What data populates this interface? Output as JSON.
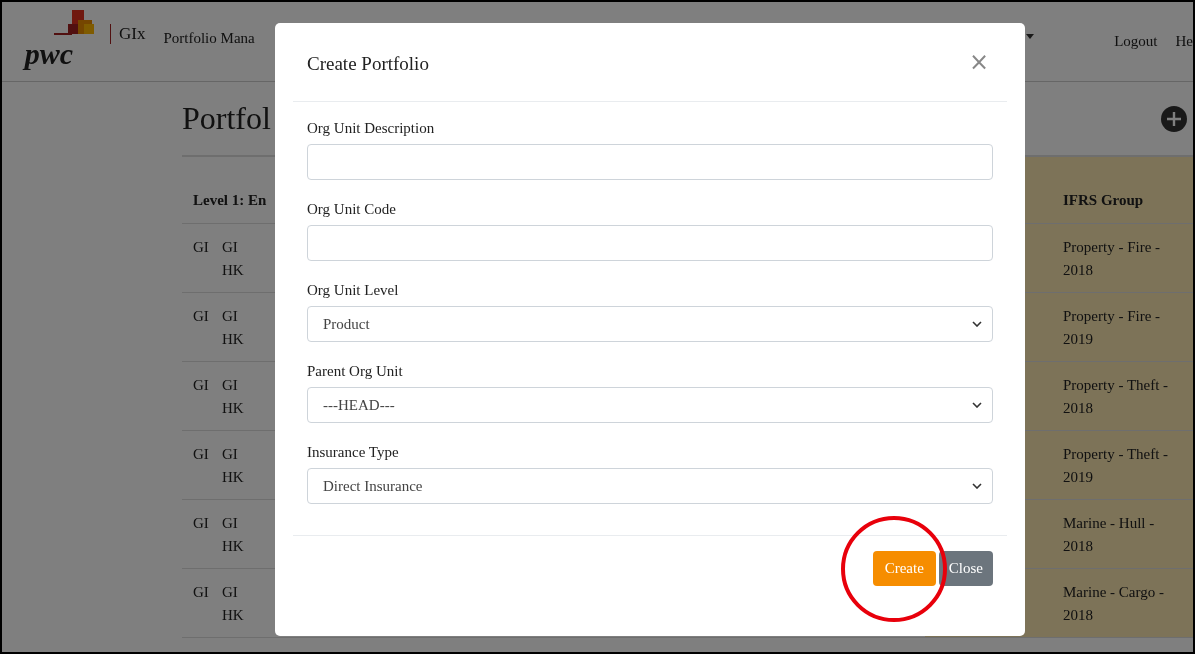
{
  "header": {
    "logo": "pwc",
    "product": "GIx",
    "nav": [
      "Portfolio Mana"
    ],
    "links": [
      "Logout",
      "He"
    ]
  },
  "page": {
    "title": "Portfol",
    "table": {
      "columns": [
        {
          "label": "Level 1: En",
          "highlighted": false
        },
        {
          "label": "IFRS Group",
          "highlighted": true
        }
      ],
      "rows": [
        {
          "level_1": "GI",
          "column_2": "GI HK",
          "ifrs_group": "Property - Fire - 2018"
        },
        {
          "level_1": "GI",
          "column_2": "GI HK",
          "ifrs_group": "Property - Fire - 2019"
        },
        {
          "level_1": "GI",
          "column_2": "GI HK",
          "ifrs_group": "Property - Theft - 2018"
        },
        {
          "level_1": "GI",
          "column_2": "GI HK",
          "ifrs_group": "Property - Theft - 2019"
        },
        {
          "level_1": "GI",
          "column_2": "GI HK",
          "ifrs_group": "Marine - Hull - 2018"
        },
        {
          "level_1": "GI",
          "column_2": "GI HK",
          "ifrs_group": "Marine - Cargo - 2018"
        }
      ]
    }
  },
  "modal": {
    "title": "Create Portfolio",
    "close": "×",
    "fields": [
      {
        "label": "Org Unit Description",
        "kind": "text"
      },
      {
        "label": "Org Unit Code",
        "kind": "text"
      },
      {
        "label": "Org Unit Level",
        "kind": "select",
        "value": "Product"
      },
      {
        "label": "Parent Org Unit",
        "kind": "select",
        "value": "---HEAD---"
      },
      {
        "label": "Insurance Type",
        "kind": "select",
        "value": "Direct Insurance"
      }
    ],
    "buttons": [
      {
        "label": "Create",
        "kind": "primary",
        "highlighted": true
      },
      {
        "label": "Close",
        "kind": "secondary"
      }
    ]
  }
}
